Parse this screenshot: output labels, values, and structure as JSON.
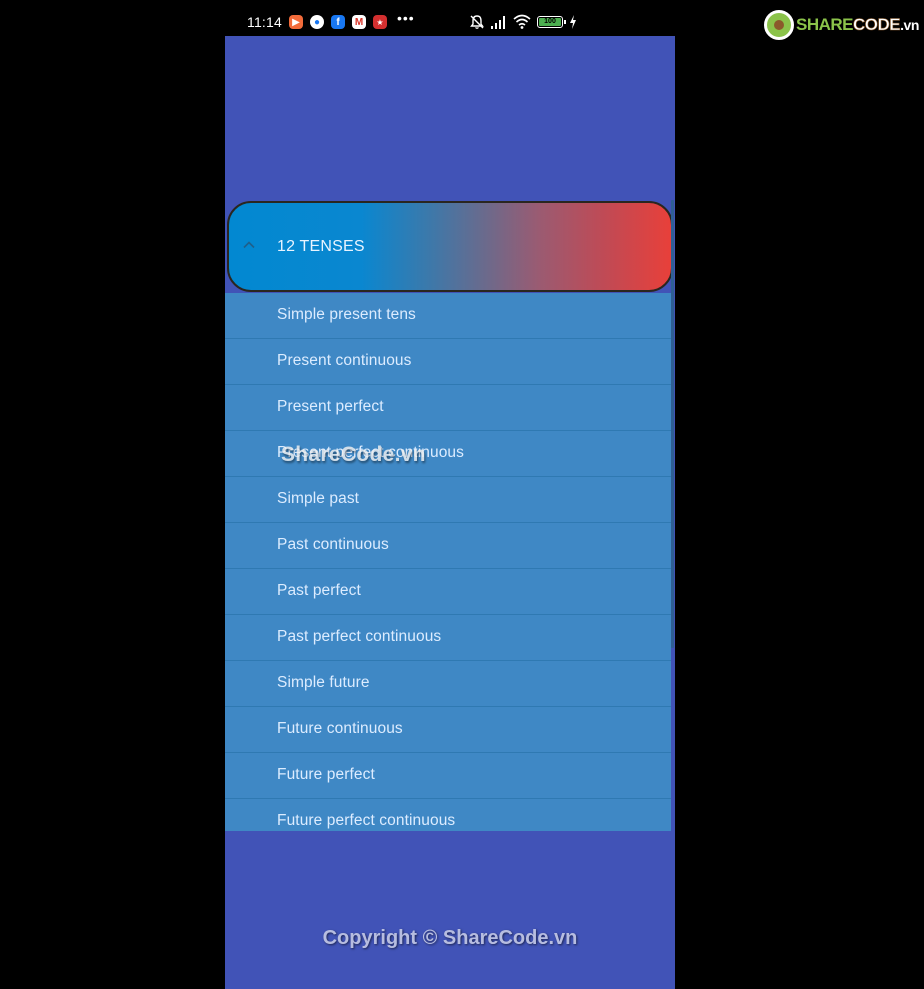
{
  "status_bar": {
    "time": "11:14",
    "notification_icons": [
      {
        "name": "video-call-app-icon",
        "color": "#F26B3A",
        "glyph": "▶"
      },
      {
        "name": "messenger-app-icon",
        "color": "#1877F2",
        "glyph": "●"
      },
      {
        "name": "facebook-app-icon",
        "color": "#1877F2",
        "glyph": "f"
      },
      {
        "name": "gmail-app-icon",
        "color": "#FFFFFF",
        "glyph": "M"
      },
      {
        "name": "news-app-icon",
        "color": "#D32F2F",
        "glyph": "★"
      }
    ],
    "more_indicator": "•••",
    "battery_level": "100",
    "signal_bars": 4,
    "wifi": true,
    "charging": true,
    "silent_mode": true
  },
  "logo": {
    "share": "SHARE",
    "code": "CODE",
    "tld": ".vn"
  },
  "header": {
    "title": "12 TENSES",
    "expanded": true,
    "gradient_start": "#0288D1",
    "gradient_end": "#E8403A"
  },
  "tenses": [
    {
      "label": "Simple present tens"
    },
    {
      "label": "Present continuous"
    },
    {
      "label": "Present perfect"
    },
    {
      "label": "Present perfect continuous"
    },
    {
      "label": "Simple past"
    },
    {
      "label": "Past continuous"
    },
    {
      "label": "Past perfect"
    },
    {
      "label": "Past perfect continuous"
    },
    {
      "label": "Simple future"
    },
    {
      "label": "Future continuous"
    },
    {
      "label": "Future perfect"
    },
    {
      "label": "Future perfect continuous"
    }
  ],
  "watermark": "ShareCode.vn",
  "footer": {
    "copyright": "Copyright © ShareCode.vn"
  },
  "colors": {
    "screen_background": "#4153B7",
    "list_background": "#3F88C5"
  }
}
